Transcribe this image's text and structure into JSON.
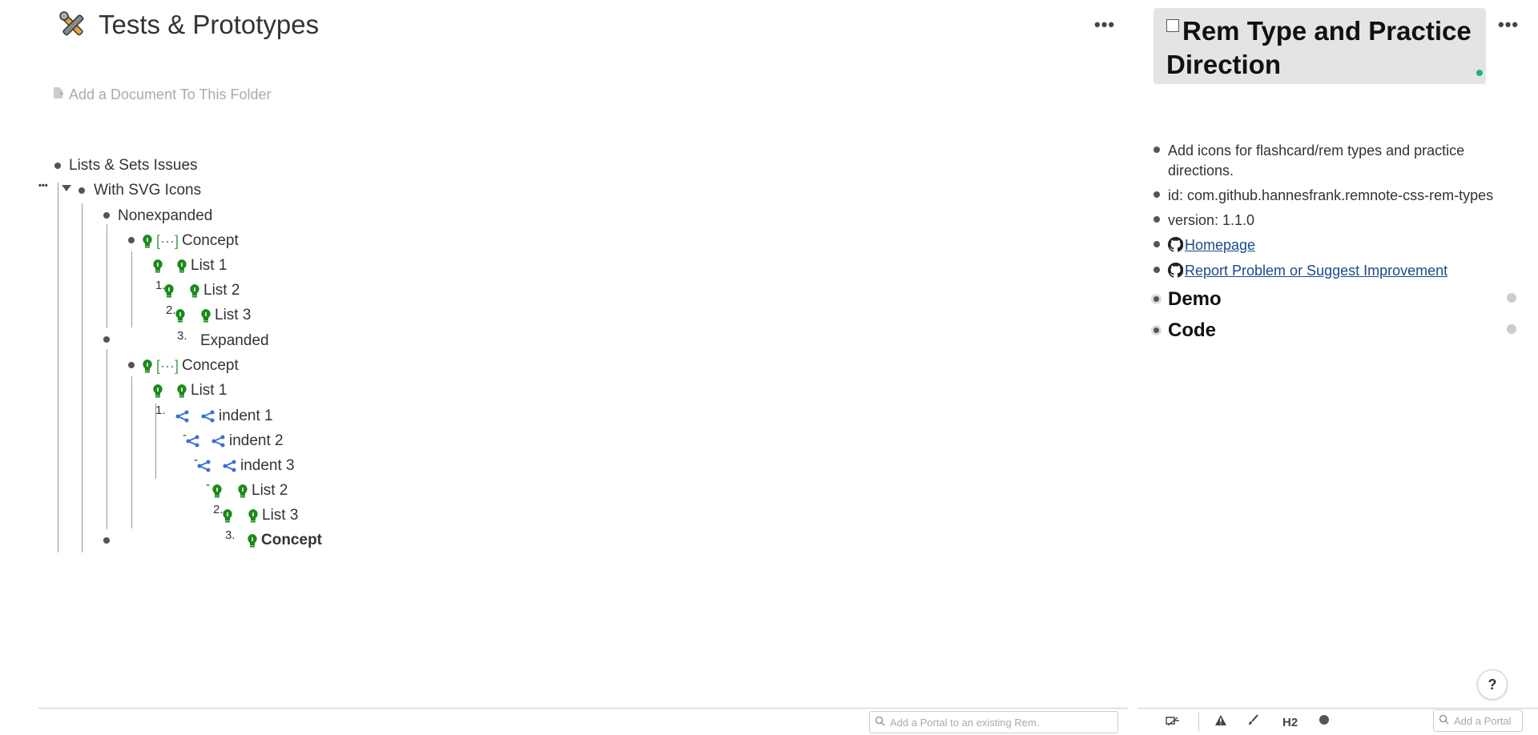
{
  "page": {
    "title": "Tests & Prototypes",
    "more_label": "•••",
    "add_document": "Add a Document To This Folder"
  },
  "tree": {
    "lists_sets": "Lists & Sets Issues",
    "with_svg": "With SVG Icons",
    "collapse_dots": "•••",
    "nonexpanded": "Nonexpanded",
    "concept1": "Concept",
    "cloze": "[···]",
    "list1a": "List 1",
    "list2a": "List 2",
    "list3a": "List 3",
    "expanded": "Expanded",
    "concept2": "Concept",
    "list1b": "List 1",
    "indent1": "indent 1",
    "indent2": "indent 2",
    "indent3": "indent 3",
    "list2b": "List 2",
    "list3b": "List 3",
    "concept_bold": "Concept",
    "n1": "1.",
    "n2": "2.",
    "n3": "3.",
    "n1b": "1.",
    "n2b": "2.",
    "n3b": "3.",
    "dash": "-"
  },
  "right": {
    "title": "Rem Type and Practice Direction",
    "more_label": "•••",
    "desc": "Add icons for flashcard/rem types and practice directions.",
    "id": "id: com.github.hannesfrank.remnote-css-rem-types",
    "version": "version: 1.1.0",
    "homepage": "Homepage",
    "report": "Report Problem or Suggest Improvement",
    "demo": "Demo",
    "code": "Code"
  },
  "bottom": {
    "portal_placeholder": "Add a Portal to an existing Rem.",
    "portal_placeholder_short": "Add a Portal",
    "h2": "H2",
    "help": "?"
  },
  "colors": {
    "bulb_green": "#1b8a1b",
    "share_blue": "#3a6fd8",
    "accent_dot": "#1cb38a"
  }
}
